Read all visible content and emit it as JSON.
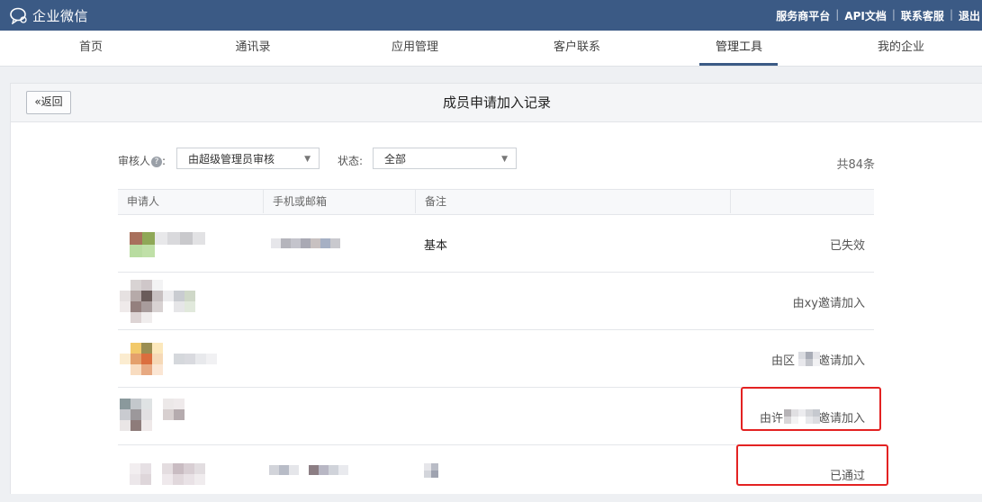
{
  "app": {
    "name": "企业微信"
  },
  "topbar": {
    "links": [
      "服务商平台",
      "API文档",
      "联系客服",
      "退出"
    ]
  },
  "nav": {
    "items": [
      {
        "label": "首页"
      },
      {
        "label": "通讯录"
      },
      {
        "label": "应用管理"
      },
      {
        "label": "客户联系"
      },
      {
        "label": "管理工具",
        "active": true
      },
      {
        "label": "我的企业"
      }
    ]
  },
  "page": {
    "back_label": "返回",
    "title": "成员申请加入记录"
  },
  "filters": {
    "reviewer_label": "审核人",
    "reviewer_value": "由超级管理员审核",
    "status_label": "状态:",
    "status_value": "全部",
    "total": "共84条"
  },
  "table": {
    "columns": [
      "申请人",
      "手机或邮箱",
      "备注"
    ],
    "rows": [
      {
        "note": "基本",
        "status": "已失效"
      },
      {
        "note": "",
        "status": "由xy邀请加入"
      },
      {
        "note": "",
        "status": "由区　　邀请加入"
      },
      {
        "note": "",
        "status": "由许　　　邀请加入"
      },
      {
        "note": "",
        "status": "已通过"
      }
    ]
  },
  "colors": {
    "topbar": "#3b5a85",
    "highlight": "#e32222"
  }
}
